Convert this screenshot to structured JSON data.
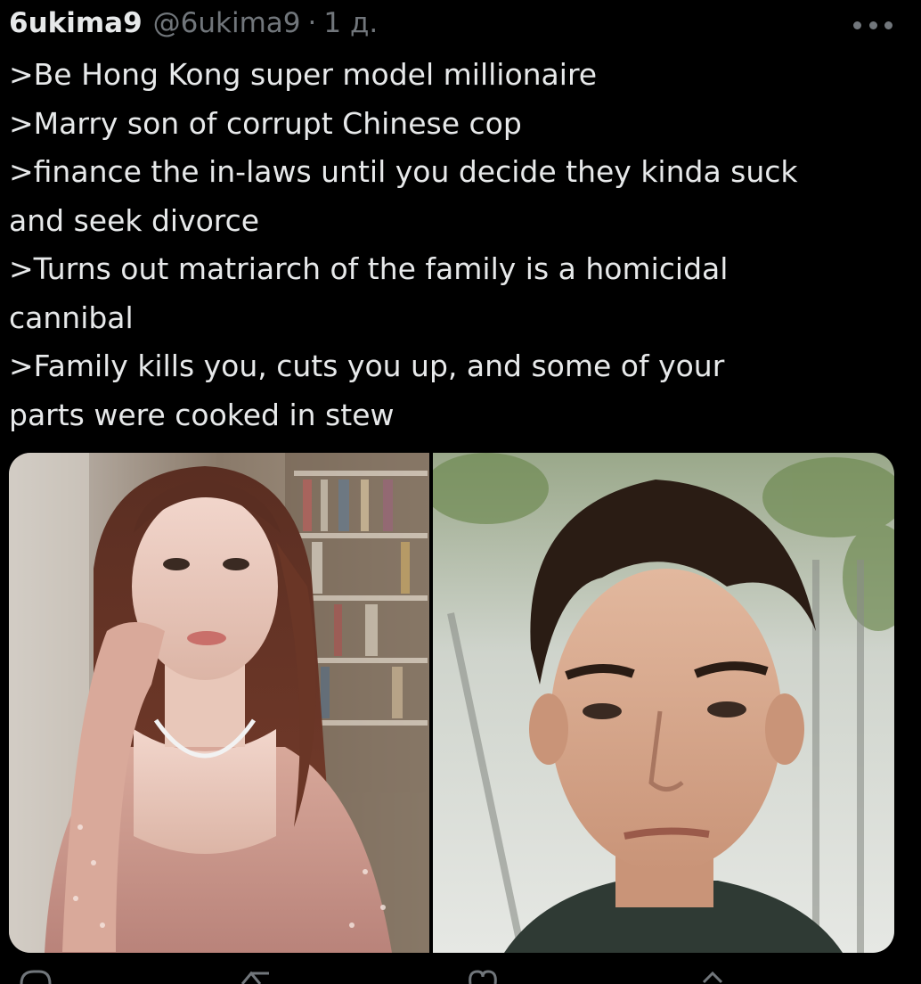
{
  "tweet": {
    "display_name": "6ukima9",
    "handle": "@6ukima9",
    "separator": "·",
    "time": "1 д.",
    "lines": [
      ">Be Hong Kong super model millionaire",
      ">Marry son of corrupt Chinese cop",
      ">finance the in-laws until you decide they kinda suck",
      "and seek divorce",
      ">Turns out matriarch of the family is a homicidal",
      "cannibal",
      ">Family kills you, cuts you up, and some of your",
      "parts were cooked in stew"
    ]
  },
  "icons": {
    "more": "more-icon",
    "reply": "reply-icon",
    "retweet": "retweet-icon",
    "like": "like-icon",
    "share": "share-icon"
  },
  "colors": {
    "background": "#000000",
    "text": "#e7e9ea",
    "secondary": "#71767b"
  }
}
